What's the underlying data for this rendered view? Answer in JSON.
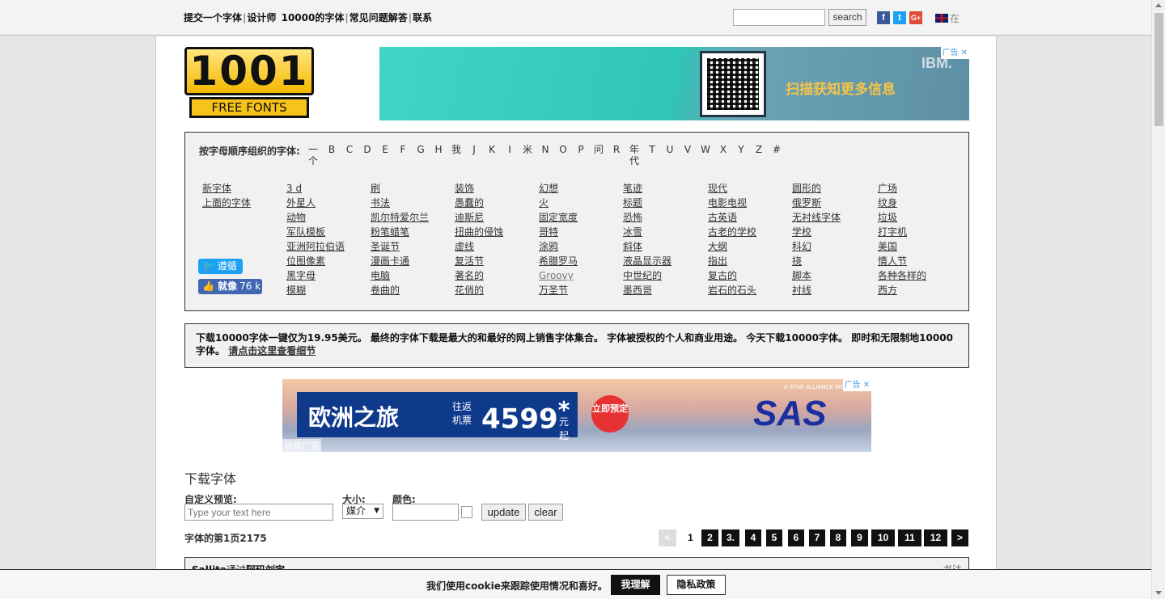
{
  "topnav": {
    "links": [
      "提交一个字体",
      "设计师",
      "10000的字体",
      "常见问题解答",
      "联系"
    ],
    "search_placeholder": "",
    "search_button": "search",
    "social": [
      "f",
      "t",
      "G+"
    ],
    "lang_label": "在"
  },
  "logo": {
    "digits": "1001",
    "sub": "FREE FONTS"
  },
  "ad_top": {
    "message": "扫描获知更多信息",
    "brand": "IBM.",
    "badge": "广告"
  },
  "alphabet": {
    "label": "按字母顺序组织的字体:",
    "letters": [
      "一个",
      "B",
      "C",
      "D",
      "E",
      "F",
      "G",
      "H",
      "我",
      "J",
      "K",
      "I",
      "米",
      "N",
      "O",
      "P",
      "问",
      "R",
      "年代",
      "T",
      "U",
      "V",
      "W",
      "X",
      "Y",
      "Z",
      "#"
    ]
  },
  "categories": {
    "col0": [
      "新字体",
      "上面的字体"
    ],
    "col1": [
      "3 d",
      "外星人",
      "动物",
      "军队模板",
      "亚洲阿拉伯语",
      "位图像素",
      "黑字母",
      "模糊"
    ],
    "col2": [
      "刷",
      "书法",
      "凯尔特爱尔兰",
      "粉笔蜡笔",
      "圣诞节",
      "漫画卡通",
      "电脑",
      "卷曲的"
    ],
    "col3": [
      "装饰",
      "愚蠢的",
      "迪斯尼",
      "扭曲的侵蚀",
      "虚线",
      "复活节",
      "著名的",
      "花俏的"
    ],
    "col4": [
      "幻想",
      "火",
      "固定宽度",
      "哥特",
      "涂鸦",
      "希腊罗马",
      "Groovy",
      "万圣节"
    ],
    "col5": [
      "笔迹",
      "标题",
      "恐怖",
      "冰雪",
      "斜体",
      "液晶显示器",
      "中世纪的",
      "墨西哥"
    ],
    "col6": [
      "现代",
      "电影电视",
      "古英语",
      "古老的学校",
      "大纲",
      "指出",
      "复古的",
      "岩石的石头"
    ],
    "col7": [
      "圆形的",
      "俄罗斯",
      "无衬线字体",
      "学校",
      "科幻",
      "挠",
      "脚本",
      "衬线"
    ],
    "col8": [
      "广场",
      "纹身",
      "垃圾",
      "打字机",
      "美国",
      "情人节",
      "各种各样的",
      "西方"
    ]
  },
  "social_buttons": {
    "follow": "遵循",
    "like": "就像",
    "like_count": "76 k"
  },
  "promo": {
    "text": "下载10000字体一键仅为19.95美元。 最终的字体下载是最大的和最好的网上销售字体集合。 字体被授权的个人和商业用途。 今天下载10000字体。 即时和无限制地10000字体。",
    "link": "请点击这里查看细节"
  },
  "ad_mid": {
    "headline": "欧洲之旅",
    "roundtrip": "往返",
    "ticket": "机票",
    "price": "4599",
    "star": "*",
    "unit": "元起",
    "cta": "立即预定",
    "brand": "SAS",
    "alliance": "A STAR ALLIANCE MEMBER",
    "badge": "广告",
    "google": "谷歌广告"
  },
  "download": {
    "title": "下载字体",
    "preview_label": "自定义预览:",
    "preview_placeholder": "Type your text here",
    "size_label": "大小:",
    "size_value": "媒介",
    "color_label": "颜色:",
    "update": "update",
    "clear": "clear",
    "page_count": "字体的第1页2175"
  },
  "pagination": [
    "<",
    "1",
    "2",
    "3.",
    "4",
    "5",
    "6",
    "7",
    "8",
    "9",
    "10",
    "11",
    "12",
    ">"
  ],
  "font_row": {
    "name": "Sallita",
    "by": "通过",
    "designer": "阿玛刘宇",
    "category": "书法"
  },
  "cookie": {
    "text": "我们使用cookie来跟踪使用情况和喜好。",
    "accept": "我理解",
    "policy": "隐私政策"
  }
}
